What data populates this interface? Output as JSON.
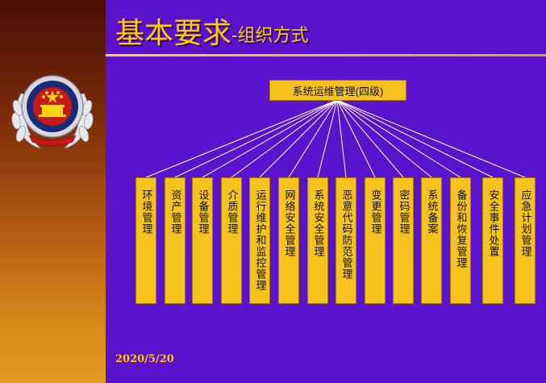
{
  "title": {
    "main": "基本要求",
    "sub": "-组织方式"
  },
  "date": "2020/5/20",
  "root": {
    "label": "系统运维管理(四级)"
  },
  "children": [
    {
      "label": "环境管理"
    },
    {
      "label": "资产管理"
    },
    {
      "label": "设备管理"
    },
    {
      "label": "介质管理"
    },
    {
      "label": "运行维护和监控管理"
    },
    {
      "label": "网络安全管理"
    },
    {
      "label": "系统安全管理"
    },
    {
      "label": "恶意代码防范管理"
    },
    {
      "label": "变更管理"
    },
    {
      "label": "密码管理"
    },
    {
      "label": "系统备案"
    },
    {
      "label": "备份和恢复管理"
    },
    {
      "label": "安全事件处置"
    },
    {
      "label": "应急计划管理"
    }
  ],
  "colors": {
    "background": "#5a12cc",
    "box": "#f6c21e",
    "title": "#ffcc00",
    "line": "#ffffff"
  }
}
